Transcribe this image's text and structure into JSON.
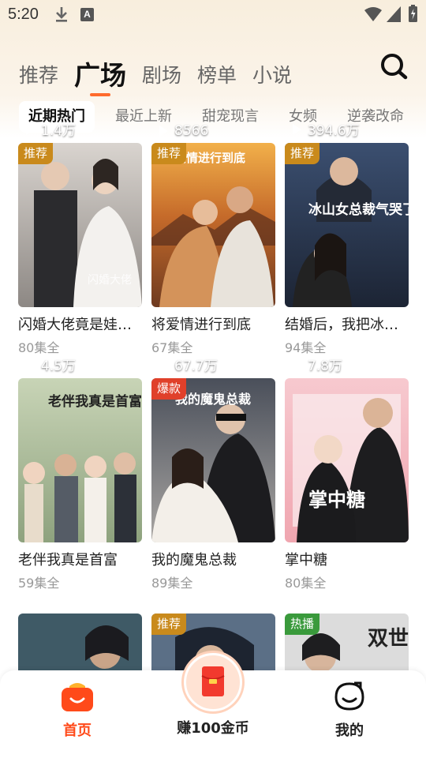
{
  "status": {
    "time": "5:20",
    "notif_icon": "A"
  },
  "top_tabs": [
    {
      "label": "推荐",
      "active": false
    },
    {
      "label": "广场",
      "active": true
    },
    {
      "label": "剧场",
      "active": false
    },
    {
      "label": "榜单",
      "active": false
    },
    {
      "label": "小说",
      "active": false
    }
  ],
  "chips": [
    {
      "label": "近期热门",
      "active": true
    },
    {
      "label": "最近上新",
      "active": false
    },
    {
      "label": "甜宠现言",
      "active": false
    },
    {
      "label": "女频",
      "active": false
    },
    {
      "label": "逆袭改命",
      "active": false
    }
  ],
  "cards": [
    {
      "title": "闪婚大佬竟是娃…",
      "eps": "80集全",
      "views": "1.4万",
      "badge": "推荐",
      "poster_text": "闪婚大佬"
    },
    {
      "title": "将爱情进行到底",
      "eps": "67集全",
      "views": "8566",
      "badge": "推荐",
      "poster_text": "将爱情进行到底"
    },
    {
      "title": "结婚后，我把冰…",
      "eps": "94集全",
      "views": "394.6万",
      "badge": "推荐",
      "poster_text": "冰山女总裁气哭了"
    },
    {
      "title": "老伴我真是首富",
      "eps": "59集全",
      "views": "4.5万",
      "badge": "",
      "poster_text": "老伴我真是首富"
    },
    {
      "title": "我的魔鬼总裁",
      "eps": "89集全",
      "views": "67.7万",
      "badge": "爆款",
      "poster_text": "我的魔鬼总裁"
    },
    {
      "title": "掌中糖",
      "eps": "80集全",
      "views": "7.8万",
      "badge": "",
      "poster_text": "掌中糖"
    },
    {
      "title": "",
      "eps": "",
      "views": "",
      "badge": "",
      "poster_text": ""
    },
    {
      "title": "",
      "eps": "",
      "views": "",
      "badge": "推荐",
      "poster_text": ""
    },
    {
      "title": "",
      "eps": "",
      "views": "",
      "badge": "热播",
      "poster_text": "双世"
    }
  ],
  "badge_colors": {
    "推荐": "#c98a1c",
    "爆款": "#e0402a",
    "热播": "#3a9a3c"
  },
  "nav": {
    "home": "首页",
    "earn": "赚100金币",
    "mine": "我的"
  },
  "colors": {
    "accent": "#ff6a2c",
    "nav_active": "#ff4a1a"
  }
}
